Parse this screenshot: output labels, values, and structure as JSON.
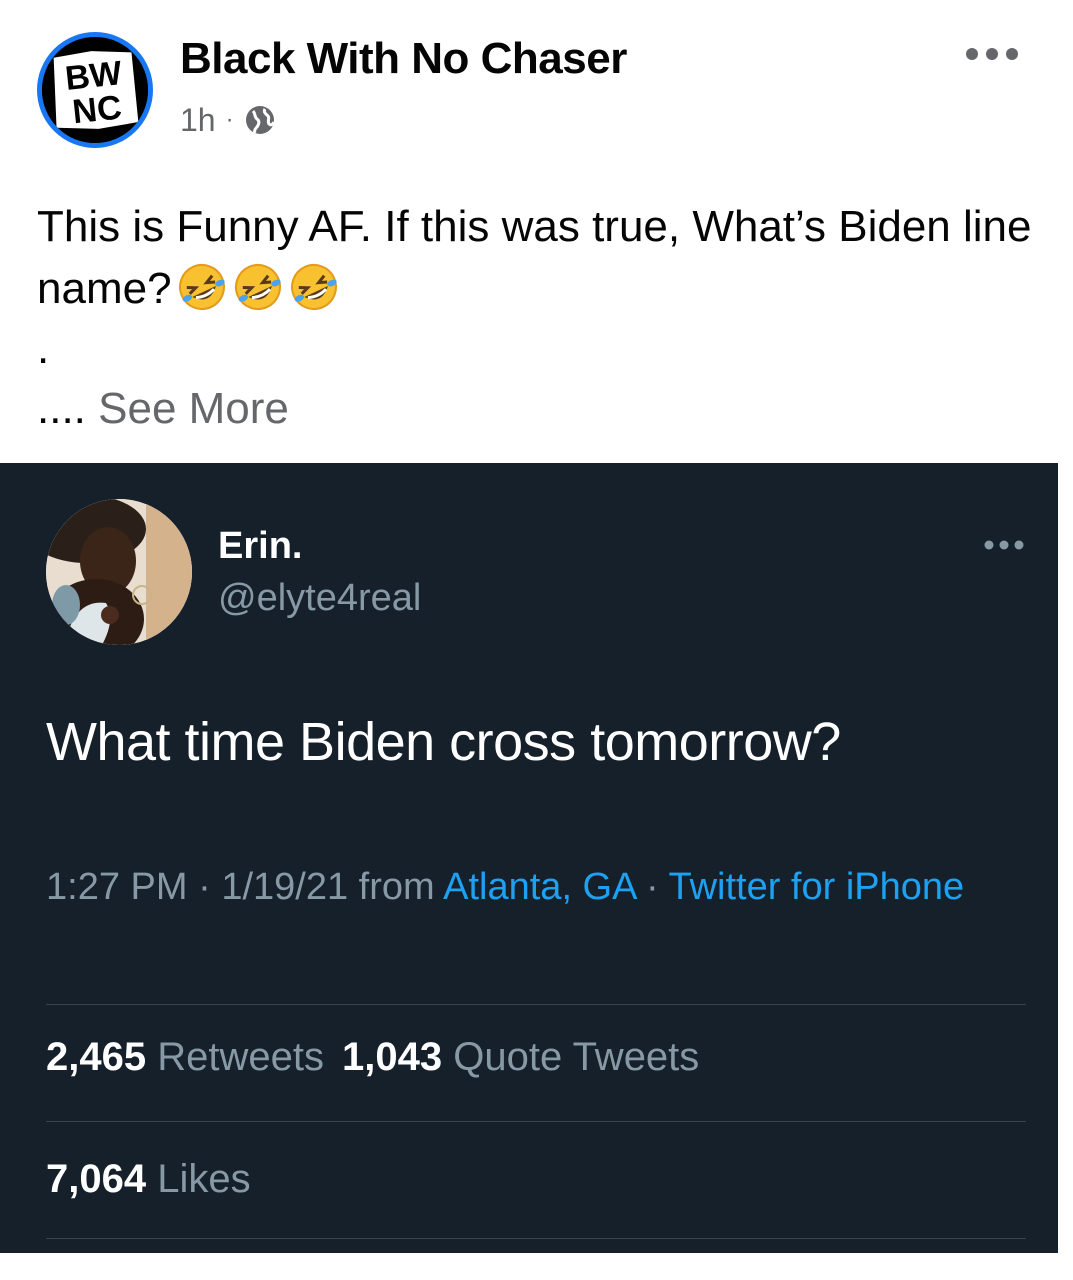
{
  "facebook_post": {
    "page_name": "Black With No Chaser",
    "logo_text": "BWNC",
    "time": "1h",
    "separator": "·",
    "privacy_icon": "globe-icon",
    "more_icon": "more-horizontal-icon",
    "text_line": "This is Funny AF. If this was true, What’s Biden line name?",
    "emojis": [
      "rolling-on-floor-laughing",
      "rolling-on-floor-laughing",
      "rolling-on-floor-laughing"
    ],
    "dot_line": ".",
    "see_more_prefix": "....",
    "see_more_label": "See More",
    "colors": {
      "accent": "#1877f2",
      "text": "#050505",
      "secondary": "#65676b"
    }
  },
  "tweet": {
    "display_name": "Erin.",
    "handle": "@elyte4real",
    "more_icon": "more-horizontal-icon",
    "text": "What time Biden cross tomorrow?",
    "time": "1:27 PM",
    "date": "1/19/21",
    "from_label": "from",
    "location": "Atlanta, GA",
    "source": "Twitter for iPhone",
    "sep": "·",
    "retweets_count": "2,465",
    "retweets_label": "Retweets",
    "quote_count": "1,043",
    "quote_label": "Quote Tweets",
    "likes_count": "7,064",
    "likes_label": "Likes",
    "colors": {
      "background": "#15202b",
      "link": "#1da1f2",
      "muted": "#8899a6",
      "text": "#ffffff"
    }
  }
}
